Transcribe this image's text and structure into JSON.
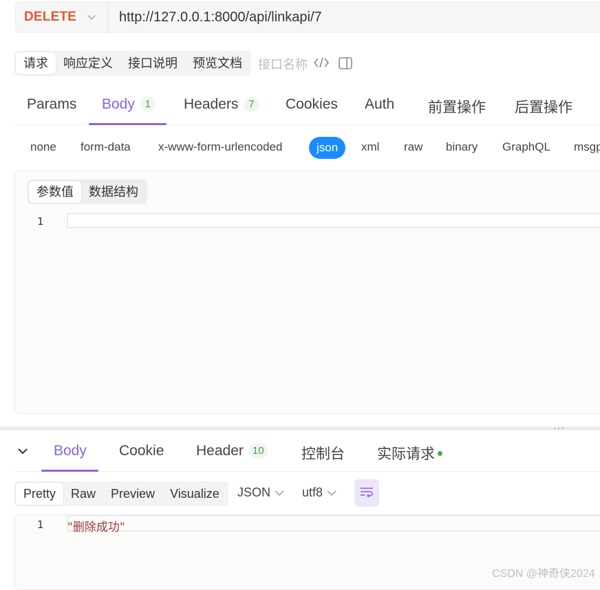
{
  "request": {
    "method": "DELETE",
    "url": "http://127.0.0.1:8000/api/linkapi/7"
  },
  "top_tabs": {
    "items": [
      "请求",
      "响应定义",
      "接口说明",
      "预览文档"
    ],
    "interface_name_placeholder": "接口名称"
  },
  "request_tabs": {
    "items": [
      {
        "label": "Params"
      },
      {
        "label": "Body",
        "badge": "1"
      },
      {
        "label": "Headers",
        "badge": "7"
      },
      {
        "label": "Cookies"
      },
      {
        "label": "Auth"
      },
      {
        "label": "前置操作"
      },
      {
        "label": "后置操作"
      }
    ],
    "active": "Body"
  },
  "body_types": {
    "items": [
      "none",
      "form-data",
      "x-www-form-urlencoded",
      "json",
      "xml",
      "raw",
      "binary",
      "GraphQL",
      "msgp"
    ],
    "active": "json"
  },
  "editor": {
    "modes": [
      "参数值",
      "数据结构"
    ],
    "line_number": "1"
  },
  "splitter": {
    "handle": "···"
  },
  "response_tabs": {
    "items": [
      {
        "label": "Body"
      },
      {
        "label": "Cookie"
      },
      {
        "label": "Header",
        "badge": "10"
      },
      {
        "label": "控制台"
      },
      {
        "label": "实际请求"
      }
    ],
    "active": "Body"
  },
  "response_toolbar": {
    "views": [
      "Pretty",
      "Raw",
      "Preview",
      "Visualize"
    ],
    "active_view": "Pretty",
    "format": "JSON",
    "encoding": "utf8"
  },
  "response_body": {
    "line_number": "1",
    "content": "\"删除成功\""
  },
  "watermark": "CSDN @神奇侠2024",
  "colors": {
    "method": "#e9552f",
    "accent": "#8c63d8",
    "json_pill": "#1a8cff",
    "badge_green": "#4f9a54"
  }
}
